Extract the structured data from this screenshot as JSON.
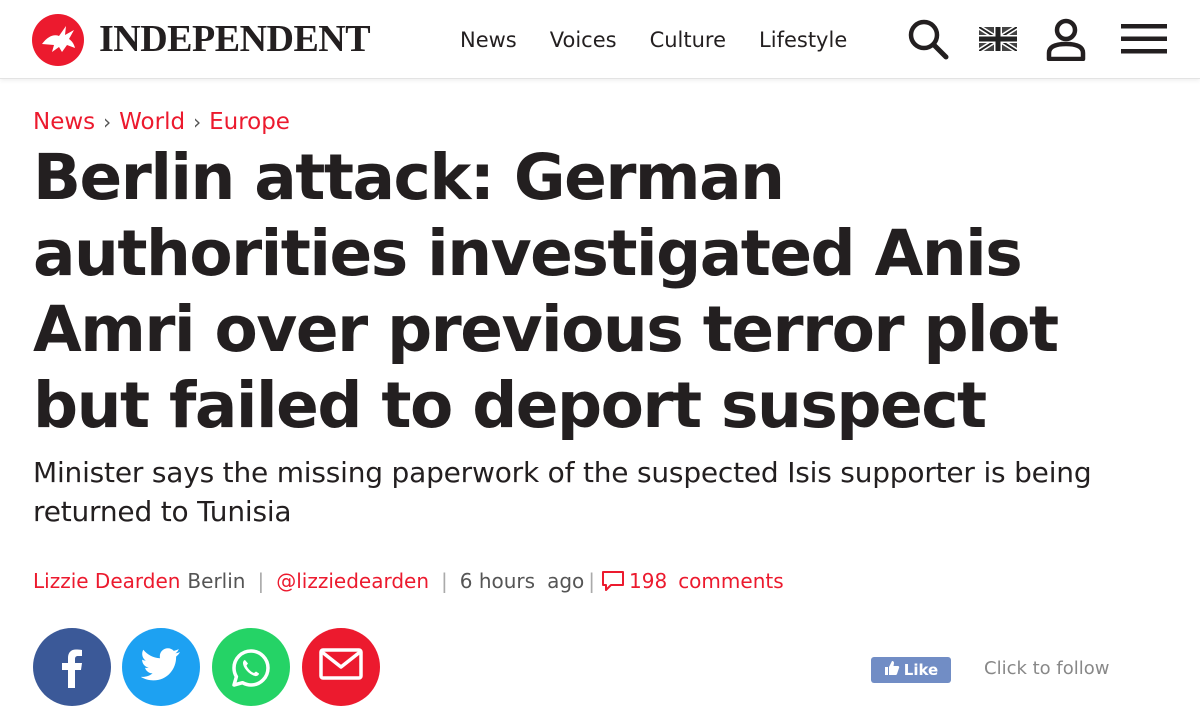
{
  "header": {
    "logo_text": "INDEPENDENT",
    "nav": [
      "News",
      "Voices",
      "Culture",
      "Lifestyle"
    ]
  },
  "breadcrumb": [
    "News",
    "World",
    "Europe"
  ],
  "article": {
    "headline": "Berlin attack: German authorities investigated Anis Amri over previous terror plot but failed to deport suspect",
    "standfirst": "Minister says the missing paperwork of the suspected Isis supporter is being returned to Tunisia",
    "author": "Lizzie Dearden",
    "location": "Berlin",
    "twitter": "@lizziedearden",
    "time_value": "6 hours",
    "time_suffix": "ago",
    "comment_count": "198",
    "comment_label": "comments"
  },
  "social": {
    "like_label": "Like",
    "follow_text": "Click to follow"
  },
  "colors": {
    "brand_red": "#ec1a2e",
    "facebook": "#3b5998",
    "twitter": "#1da1f2",
    "whatsapp": "#25d366",
    "email": "#ec1a2e"
  },
  "icons": [
    "eagle-logo-icon",
    "search-icon",
    "uk-flag-icon",
    "user-icon",
    "menu-icon",
    "comment-icon",
    "facebook-icon",
    "twitter-icon",
    "whatsapp-icon",
    "email-icon",
    "thumbs-up-icon"
  ]
}
